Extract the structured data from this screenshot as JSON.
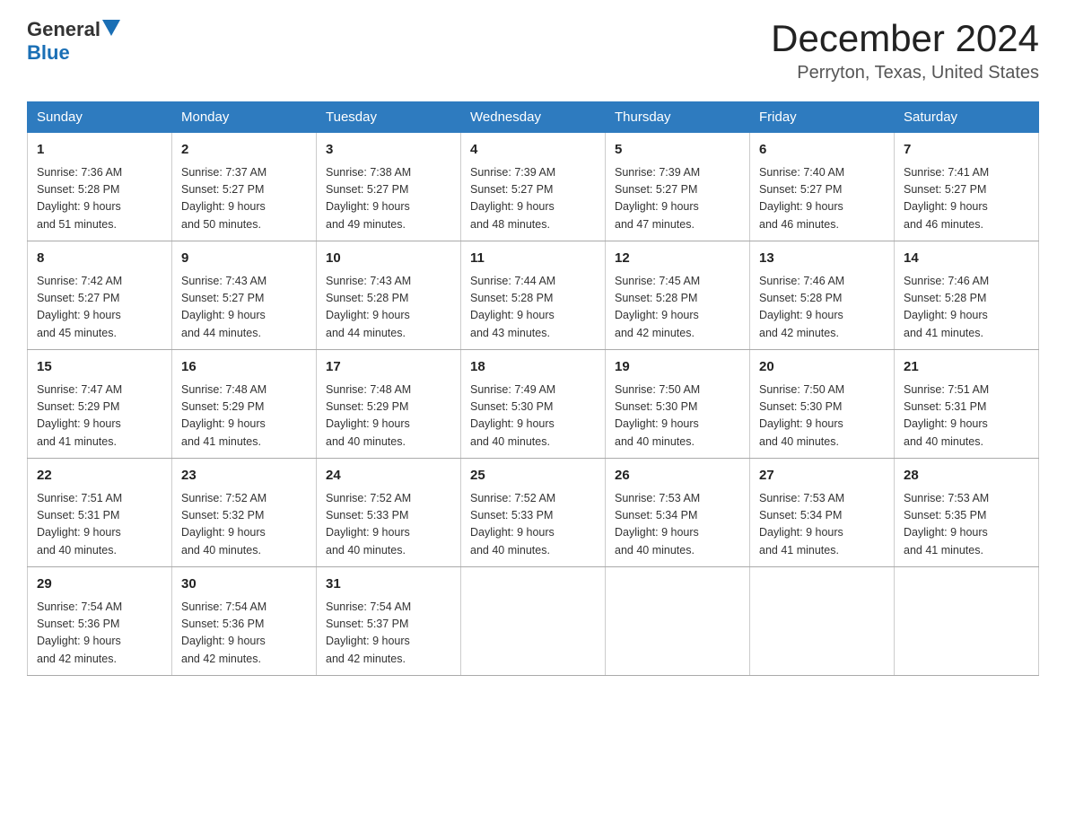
{
  "logo": {
    "text_general": "General",
    "text_blue": "Blue"
  },
  "header": {
    "month_year": "December 2024",
    "location": "Perryton, Texas, United States"
  },
  "weekdays": [
    "Sunday",
    "Monday",
    "Tuesday",
    "Wednesday",
    "Thursday",
    "Friday",
    "Saturday"
  ],
  "weeks": [
    [
      {
        "day": "1",
        "sunrise": "7:36 AM",
        "sunset": "5:28 PM",
        "daylight": "9 hours and 51 minutes."
      },
      {
        "day": "2",
        "sunrise": "7:37 AM",
        "sunset": "5:27 PM",
        "daylight": "9 hours and 50 minutes."
      },
      {
        "day": "3",
        "sunrise": "7:38 AM",
        "sunset": "5:27 PM",
        "daylight": "9 hours and 49 minutes."
      },
      {
        "day": "4",
        "sunrise": "7:39 AM",
        "sunset": "5:27 PM",
        "daylight": "9 hours and 48 minutes."
      },
      {
        "day": "5",
        "sunrise": "7:39 AM",
        "sunset": "5:27 PM",
        "daylight": "9 hours and 47 minutes."
      },
      {
        "day": "6",
        "sunrise": "7:40 AM",
        "sunset": "5:27 PM",
        "daylight": "9 hours and 46 minutes."
      },
      {
        "day": "7",
        "sunrise": "7:41 AM",
        "sunset": "5:27 PM",
        "daylight": "9 hours and 46 minutes."
      }
    ],
    [
      {
        "day": "8",
        "sunrise": "7:42 AM",
        "sunset": "5:27 PM",
        "daylight": "9 hours and 45 minutes."
      },
      {
        "day": "9",
        "sunrise": "7:43 AM",
        "sunset": "5:27 PM",
        "daylight": "9 hours and 44 minutes."
      },
      {
        "day": "10",
        "sunrise": "7:43 AM",
        "sunset": "5:28 PM",
        "daylight": "9 hours and 44 minutes."
      },
      {
        "day": "11",
        "sunrise": "7:44 AM",
        "sunset": "5:28 PM",
        "daylight": "9 hours and 43 minutes."
      },
      {
        "day": "12",
        "sunrise": "7:45 AM",
        "sunset": "5:28 PM",
        "daylight": "9 hours and 42 minutes."
      },
      {
        "day": "13",
        "sunrise": "7:46 AM",
        "sunset": "5:28 PM",
        "daylight": "9 hours and 42 minutes."
      },
      {
        "day": "14",
        "sunrise": "7:46 AM",
        "sunset": "5:28 PM",
        "daylight": "9 hours and 41 minutes."
      }
    ],
    [
      {
        "day": "15",
        "sunrise": "7:47 AM",
        "sunset": "5:29 PM",
        "daylight": "9 hours and 41 minutes."
      },
      {
        "day": "16",
        "sunrise": "7:48 AM",
        "sunset": "5:29 PM",
        "daylight": "9 hours and 41 minutes."
      },
      {
        "day": "17",
        "sunrise": "7:48 AM",
        "sunset": "5:29 PM",
        "daylight": "9 hours and 40 minutes."
      },
      {
        "day": "18",
        "sunrise": "7:49 AM",
        "sunset": "5:30 PM",
        "daylight": "9 hours and 40 minutes."
      },
      {
        "day": "19",
        "sunrise": "7:50 AM",
        "sunset": "5:30 PM",
        "daylight": "9 hours and 40 minutes."
      },
      {
        "day": "20",
        "sunrise": "7:50 AM",
        "sunset": "5:30 PM",
        "daylight": "9 hours and 40 minutes."
      },
      {
        "day": "21",
        "sunrise": "7:51 AM",
        "sunset": "5:31 PM",
        "daylight": "9 hours and 40 minutes."
      }
    ],
    [
      {
        "day": "22",
        "sunrise": "7:51 AM",
        "sunset": "5:31 PM",
        "daylight": "9 hours and 40 minutes."
      },
      {
        "day": "23",
        "sunrise": "7:52 AM",
        "sunset": "5:32 PM",
        "daylight": "9 hours and 40 minutes."
      },
      {
        "day": "24",
        "sunrise": "7:52 AM",
        "sunset": "5:33 PM",
        "daylight": "9 hours and 40 minutes."
      },
      {
        "day": "25",
        "sunrise": "7:52 AM",
        "sunset": "5:33 PM",
        "daylight": "9 hours and 40 minutes."
      },
      {
        "day": "26",
        "sunrise": "7:53 AM",
        "sunset": "5:34 PM",
        "daylight": "9 hours and 40 minutes."
      },
      {
        "day": "27",
        "sunrise": "7:53 AM",
        "sunset": "5:34 PM",
        "daylight": "9 hours and 41 minutes."
      },
      {
        "day": "28",
        "sunrise": "7:53 AM",
        "sunset": "5:35 PM",
        "daylight": "9 hours and 41 minutes."
      }
    ],
    [
      {
        "day": "29",
        "sunrise": "7:54 AM",
        "sunset": "5:36 PM",
        "daylight": "9 hours and 42 minutes."
      },
      {
        "day": "30",
        "sunrise": "7:54 AM",
        "sunset": "5:36 PM",
        "daylight": "9 hours and 42 minutes."
      },
      {
        "day": "31",
        "sunrise": "7:54 AM",
        "sunset": "5:37 PM",
        "daylight": "9 hours and 42 minutes."
      },
      null,
      null,
      null,
      null
    ]
  ],
  "labels": {
    "sunrise": "Sunrise:",
    "sunset": "Sunset:",
    "daylight": "Daylight:"
  }
}
